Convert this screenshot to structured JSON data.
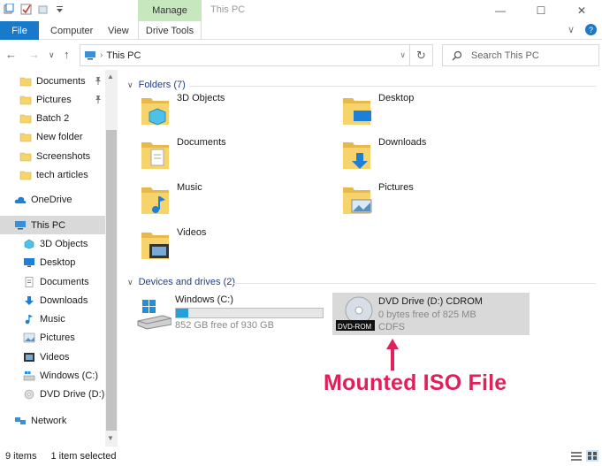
{
  "window": {
    "title": "This PC",
    "contextual_tab": "Manage"
  },
  "ribbon": {
    "tabs": [
      "File",
      "Computer",
      "View",
      "Drive Tools"
    ]
  },
  "addressbar": {
    "location": "This PC",
    "search_placeholder": "Search This PC"
  },
  "sidebar": {
    "quick_access": [
      {
        "label": "Documents",
        "icon": "documents-folder-icon",
        "pinned": true
      },
      {
        "label": "Pictures",
        "icon": "pictures-folder-icon",
        "pinned": true
      },
      {
        "label": "Batch 2",
        "icon": "folder-icon",
        "pinned": false
      },
      {
        "label": "New folder",
        "icon": "folder-icon",
        "pinned": false
      },
      {
        "label": "Screenshots",
        "icon": "folder-icon",
        "pinned": false
      },
      {
        "label": "tech articles",
        "icon": "folder-icon",
        "pinned": false
      }
    ],
    "onedrive": "OneDrive",
    "thispc": "This PC",
    "thispc_children": [
      {
        "label": "3D Objects",
        "icon": "3d-objects-icon"
      },
      {
        "label": "Desktop",
        "icon": "desktop-icon"
      },
      {
        "label": "Documents",
        "icon": "documents-icon"
      },
      {
        "label": "Downloads",
        "icon": "downloads-icon"
      },
      {
        "label": "Music",
        "icon": "music-icon"
      },
      {
        "label": "Pictures",
        "icon": "pictures-icon"
      },
      {
        "label": "Videos",
        "icon": "videos-icon"
      },
      {
        "label": "Windows (C:)",
        "icon": "drive-c-icon"
      },
      {
        "label": "DVD Drive (D:) C",
        "icon": "dvd-drive-icon"
      }
    ],
    "network": "Network"
  },
  "main": {
    "folders_header": "Folders (7)",
    "folders": [
      {
        "label": "3D Objects",
        "icon": "3d-objects-folder-icon"
      },
      {
        "label": "Desktop",
        "icon": "desktop-folder-icon"
      },
      {
        "label": "Documents",
        "icon": "documents-folder-icon"
      },
      {
        "label": "Downloads",
        "icon": "downloads-folder-icon"
      },
      {
        "label": "Music",
        "icon": "music-folder-icon"
      },
      {
        "label": "Pictures",
        "icon": "pictures-folder-icon"
      },
      {
        "label": "Videos",
        "icon": "videos-folder-icon"
      }
    ],
    "devices_header": "Devices and drives (2)",
    "drives": [
      {
        "name": "Windows (C:)",
        "free": "852 GB free of 930 GB",
        "used_fraction": 0.084
      },
      {
        "name": "DVD Drive (D:) CDROM",
        "free": "0 bytes free of 825 MB",
        "fs": "CDFS",
        "badge": "DVD-ROM"
      }
    ],
    "annotation": "Mounted ISO File"
  },
  "status": {
    "items": "9 items",
    "selected": "1 item selected"
  },
  "colors": {
    "accent": "#1979ca",
    "manage_tab": "#c7e8bf",
    "capacity": "#26a0da",
    "annotation": "#e0205a",
    "folder": "#f6d36b"
  }
}
